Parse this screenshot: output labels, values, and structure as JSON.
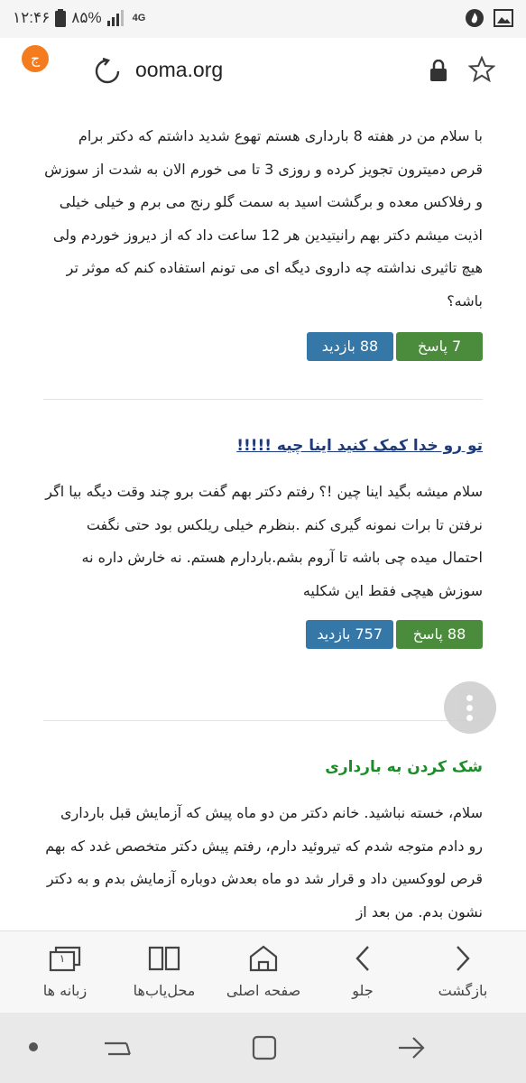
{
  "status_bar": {
    "time": "۱۲:۴۶",
    "battery": "۸۵%",
    "network": "4G"
  },
  "browser": {
    "tab_badge": "ج",
    "url": "ooma.org"
  },
  "posts": [
    {
      "title": "",
      "body": "با سلام من در هفته 8 بارداری هستم تهوع شدید داشتم که دکتر برام قرص دمیترون تجویز کرده و روزی 3 تا می خورم الان به شدت از سوزش و رفلاکس معده و برگشت اسید به سمت گلو رنج می برم و خیلی خیلی اذیت میشم دکتر بهم رانیتیدین هر 12 ساعت داد که از دیروز خوردم ولی هیچ تاثیری نداشته چه داروی دیگه ای می تونم استفاده کنم که موثر تر باشه؟",
      "replies": "7 پاسخ",
      "views": "88 بازدید"
    },
    {
      "title": "تو رو خدا کمک کنید اینا چیه !!!!!",
      "body": "سلام میشه بگید اینا چین !؟ رفتم دکتر بهم گفت برو چند وقت دیگه بیا اگر نرفتن تا برات نمونه گیری کنم .بنظرم خیلی ریلکس بود حتی نگفت احتمال میده چی باشه تا آروم بشم.باردارم هستم. نه خارش داره نه سوزش هیچی فقط این شکلیه",
      "replies": "88 پاسخ",
      "views": "757 بازدید"
    },
    {
      "title": "شک کردن به بارداری",
      "body": "سلام، خسته نباشید. خانم دکتر من دو ماه پیش که آزمایش قبل بارداری رو دادم متوجه شدم که تیروئید دارم، رفتم پیش دکتر متخصص غدد که بهم قرص لووکسین داد و قرار شد دو ماه بعدش دوباره آزمایش بدم و به دکتر نشون بدم. من بعد از"
    }
  ],
  "bottom_nav": {
    "back": "بازگشت",
    "forward": "جلو",
    "home": "صفحه اصلی",
    "bookmarks": "محل‌یاب‌ها",
    "tabs": "زبانه ها",
    "tab_count": "۱"
  }
}
